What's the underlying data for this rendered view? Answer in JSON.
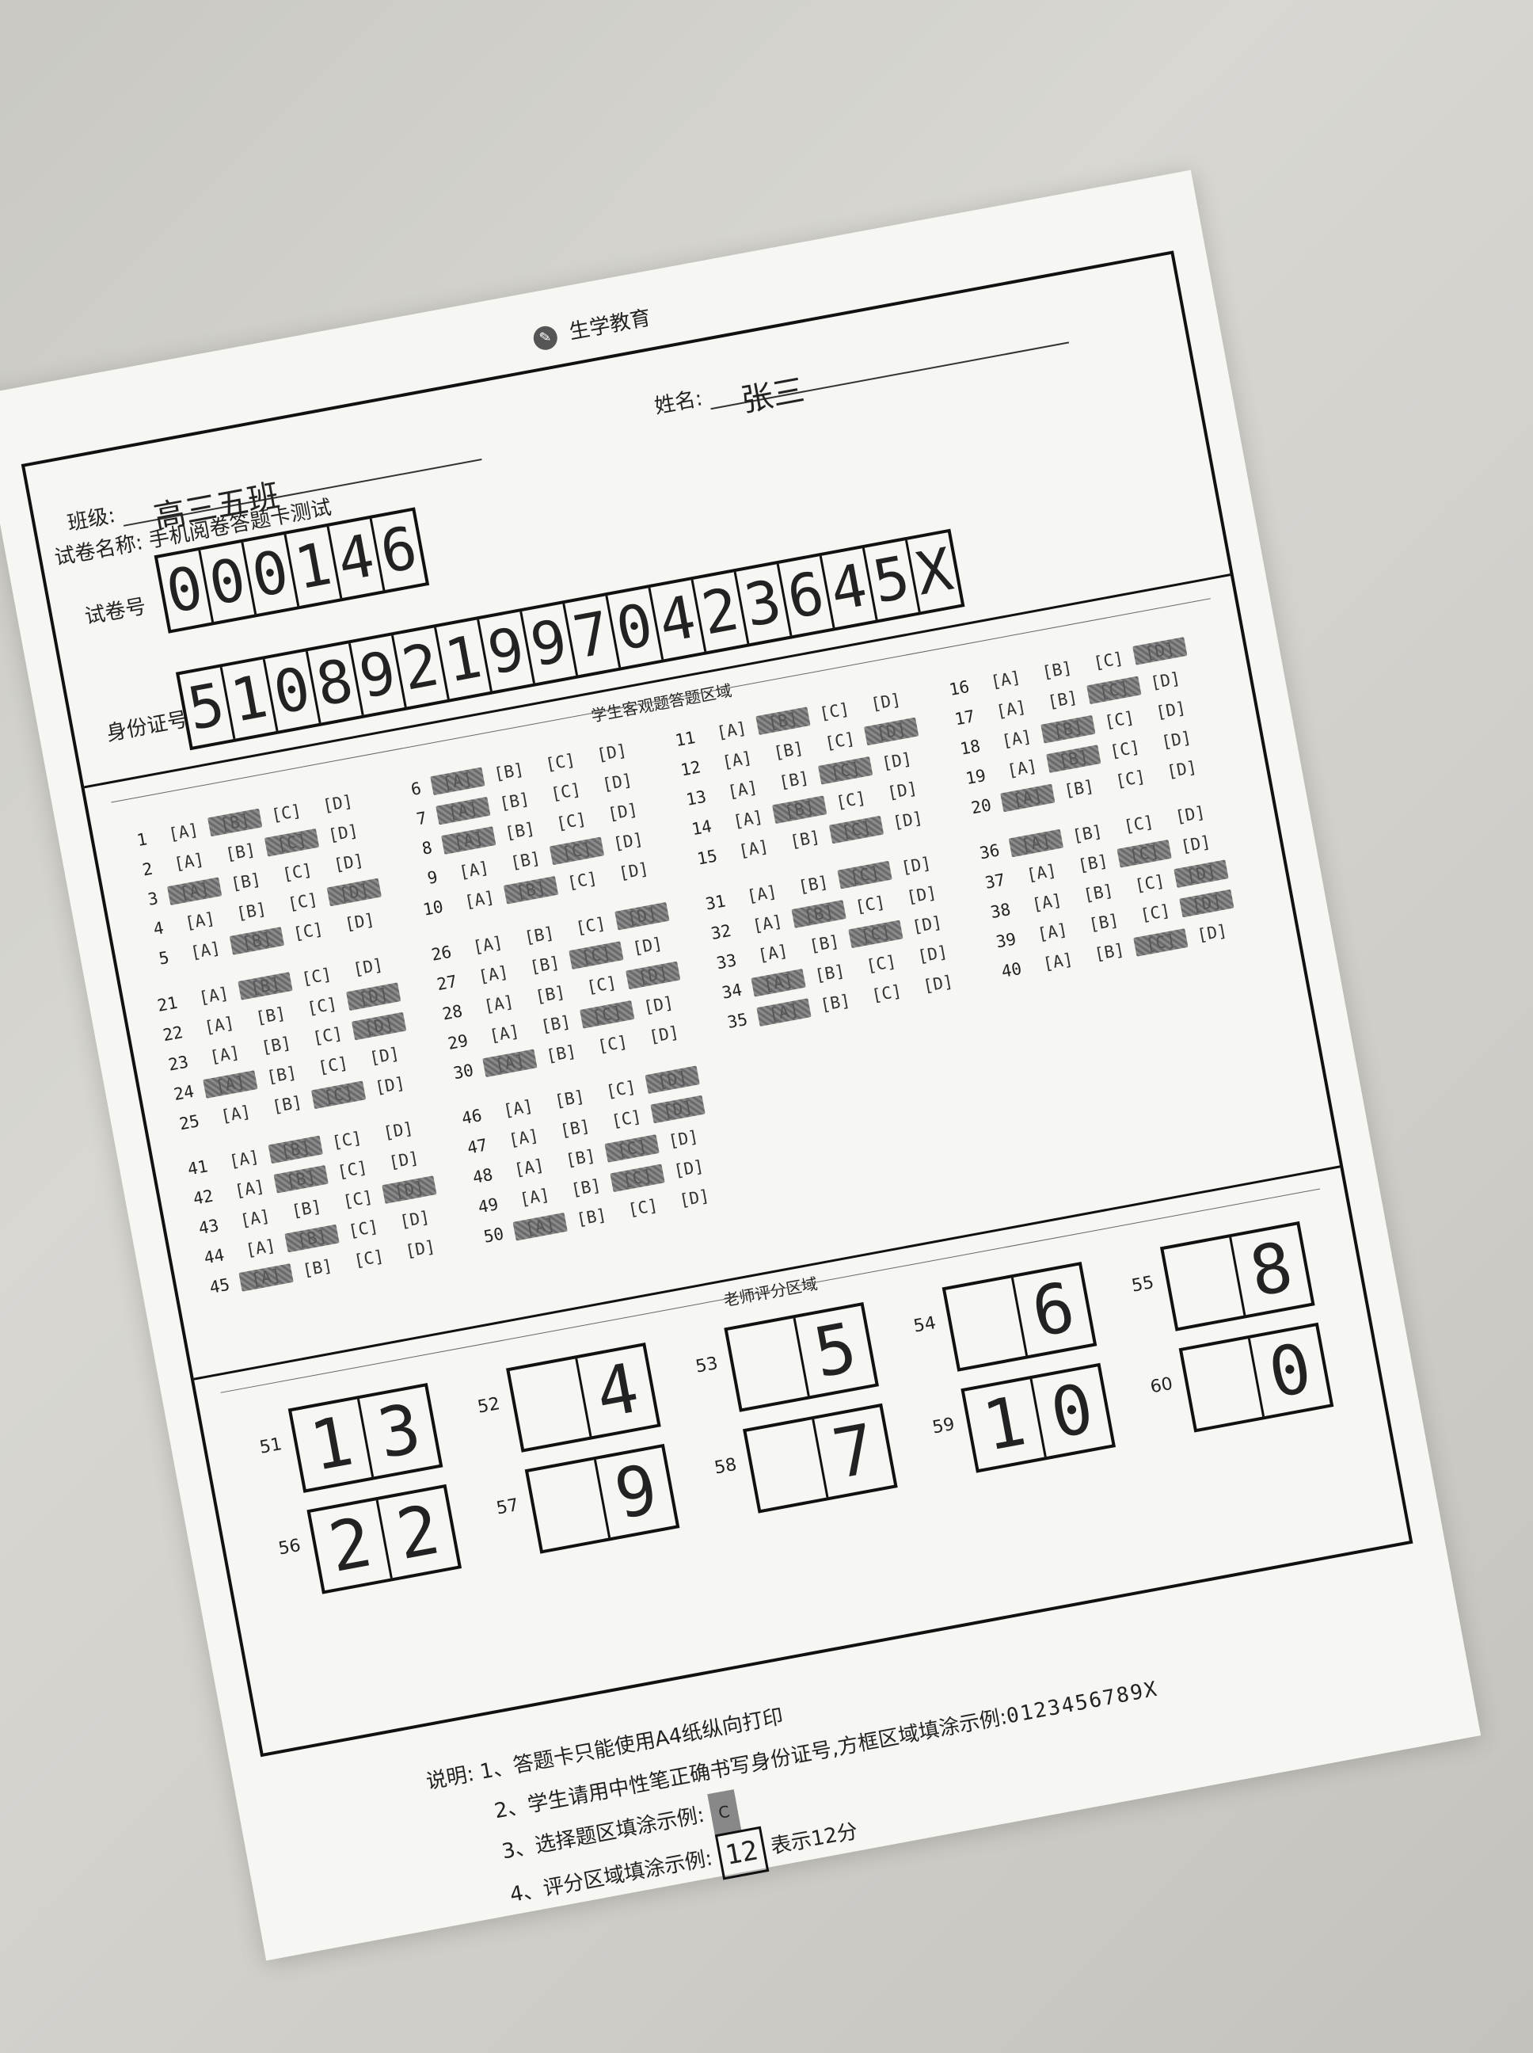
{
  "brand": "生学教育",
  "exam": {
    "label": "试卷名称:",
    "value": "手机阅卷答题卡测试"
  },
  "name": {
    "label": "姓名:",
    "value": "张三"
  },
  "class": {
    "label": "班级:",
    "value": "高三五班"
  },
  "paper_no": {
    "label": "试卷号",
    "digits": [
      "0",
      "0",
      "0",
      "1",
      "4",
      "6"
    ]
  },
  "id_no": {
    "label": "身份证号",
    "digits": [
      "5",
      "1",
      "0",
      "8",
      "9",
      "2",
      "1",
      "9",
      "9",
      "7",
      "0",
      "4",
      "2",
      "3",
      "6",
      "4",
      "5",
      "X"
    ]
  },
  "objective_title": "学生客观题答题区域",
  "teacher_title": "老师评分区域",
  "options": [
    "[A]",
    "[B]",
    "[C]",
    "[D]"
  ],
  "questions": [
    {
      "n": "1",
      "f": "B"
    },
    {
      "n": "2",
      "f": "C"
    },
    {
      "n": "3",
      "f": "A"
    },
    {
      "n": "4",
      "f": "D"
    },
    {
      "n": "5",
      "f": "B"
    },
    {
      "n": "6",
      "f": "A"
    },
    {
      "n": "7",
      "f": "A"
    },
    {
      "n": "8",
      "f": "A"
    },
    {
      "n": "9",
      "f": "C"
    },
    {
      "n": "10",
      "f": "B"
    },
    {
      "n": "11",
      "f": "B"
    },
    {
      "n": "12",
      "f": "D"
    },
    {
      "n": "13",
      "f": "C"
    },
    {
      "n": "14",
      "f": "B"
    },
    {
      "n": "15",
      "f": "C"
    },
    {
      "n": "16",
      "f": "D"
    },
    {
      "n": "17",
      "f": "C"
    },
    {
      "n": "18",
      "f": "B"
    },
    {
      "n": "19",
      "f": "B"
    },
    {
      "n": "20",
      "f": "A"
    },
    {
      "n": "21",
      "f": "B"
    },
    {
      "n": "22",
      "f": "D"
    },
    {
      "n": "23",
      "f": "D"
    },
    {
      "n": "24",
      "f": "A"
    },
    {
      "n": "25",
      "f": "C"
    },
    {
      "n": "26",
      "f": "D"
    },
    {
      "n": "27",
      "f": "C"
    },
    {
      "n": "28",
      "f": "D"
    },
    {
      "n": "29",
      "f": "C"
    },
    {
      "n": "30",
      "f": "A"
    },
    {
      "n": "31",
      "f": "C"
    },
    {
      "n": "32",
      "f": "B"
    },
    {
      "n": "33",
      "f": "C"
    },
    {
      "n": "34",
      "f": "A"
    },
    {
      "n": "35",
      "f": "A"
    },
    {
      "n": "36",
      "f": "A"
    },
    {
      "n": "37",
      "f": "C"
    },
    {
      "n": "38",
      "f": "D"
    },
    {
      "n": "39",
      "f": "D"
    },
    {
      "n": "40",
      "f": "C"
    },
    {
      "n": "41",
      "f": "B"
    },
    {
      "n": "42",
      "f": "B"
    },
    {
      "n": "43",
      "f": "D"
    },
    {
      "n": "44",
      "f": "B"
    },
    {
      "n": "45",
      "f": "A"
    },
    {
      "n": "46",
      "f": "D"
    },
    {
      "n": "47",
      "f": "D"
    },
    {
      "n": "48",
      "f": "C"
    },
    {
      "n": "49",
      "f": "C"
    },
    {
      "n": "50",
      "f": "A"
    }
  ],
  "scores": [
    {
      "n": "51",
      "v": [
        "1",
        "3"
      ]
    },
    {
      "n": "52",
      "v": [
        "",
        "4"
      ]
    },
    {
      "n": "53",
      "v": [
        "",
        "5"
      ]
    },
    {
      "n": "54",
      "v": [
        "",
        "6"
      ]
    },
    {
      "n": "55",
      "v": [
        "",
        "8"
      ]
    },
    {
      "n": "56",
      "v": [
        "2",
        "2"
      ]
    },
    {
      "n": "57",
      "v": [
        "",
        "9"
      ]
    },
    {
      "n": "58",
      "v": [
        "",
        "7"
      ]
    },
    {
      "n": "59",
      "v": [
        "1",
        "0"
      ]
    },
    {
      "n": "60",
      "v": [
        "",
        "0"
      ]
    }
  ],
  "notes": {
    "head": "说明:",
    "l1": "1、答题卡只能使用A4纸纵向打印",
    "l2": "2、学生请用中性笔正确书写身份证号,方框区域填涂示例:",
    "l2_sample": "0123456789X",
    "l3": "3、选择题区填涂示例:",
    "l3_sample": "C",
    "l4": "4、评分区域填涂示例:",
    "l4_sample": "12",
    "l4_suffix": "表示12分"
  }
}
